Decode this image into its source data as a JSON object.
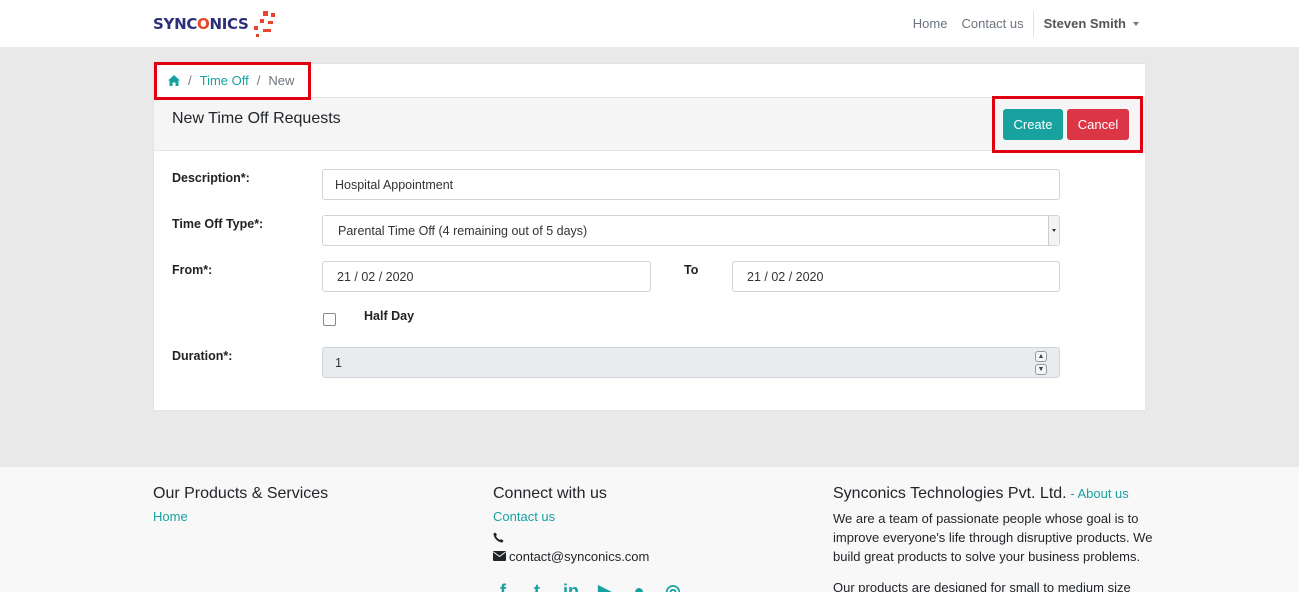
{
  "brand": {
    "name_part1": "SYNC",
    "name_o": "O",
    "name_part2": "NICS"
  },
  "nav": {
    "home": "Home",
    "contact": "Contact us",
    "user": "Steven Smith"
  },
  "breadcrumb": {
    "item1": "Time Off",
    "item2": "New"
  },
  "page": {
    "title": "New Time Off Requests",
    "create_label": "Create",
    "cancel_label": "Cancel"
  },
  "form": {
    "description_label": "Description*:",
    "description_value": "Hospital Appointment",
    "type_label": "Time Off Type*:",
    "type_value": "Parental Time Off (4 remaining out of 5 days)",
    "from_label": "From*:",
    "from_value": "21 / 02 / 2020",
    "to_label": "To",
    "to_value": "21 / 02 / 2020",
    "half_day_label": "Half Day",
    "duration_label": "Duration*:",
    "duration_value": "1"
  },
  "footer": {
    "col1_title": "Our Products & Services",
    "col1_link": "Home",
    "col2_title": "Connect with us",
    "col2_link": "Contact us",
    "email": "contact@synconics.com",
    "col3_title": "Synconics Technologies Pvt. Ltd.",
    "col3_dash": " - ",
    "col3_link": "About us",
    "about_text": "We are a team of passionate people whose goal is to improve everyone's life through disruptive products. We build great products to solve your business problems.",
    "about_text2": "Our products are designed for small to medium size"
  },
  "colors": {
    "accent": "#17a2a0",
    "danger": "#dc3545",
    "highlight": "#e00012"
  }
}
